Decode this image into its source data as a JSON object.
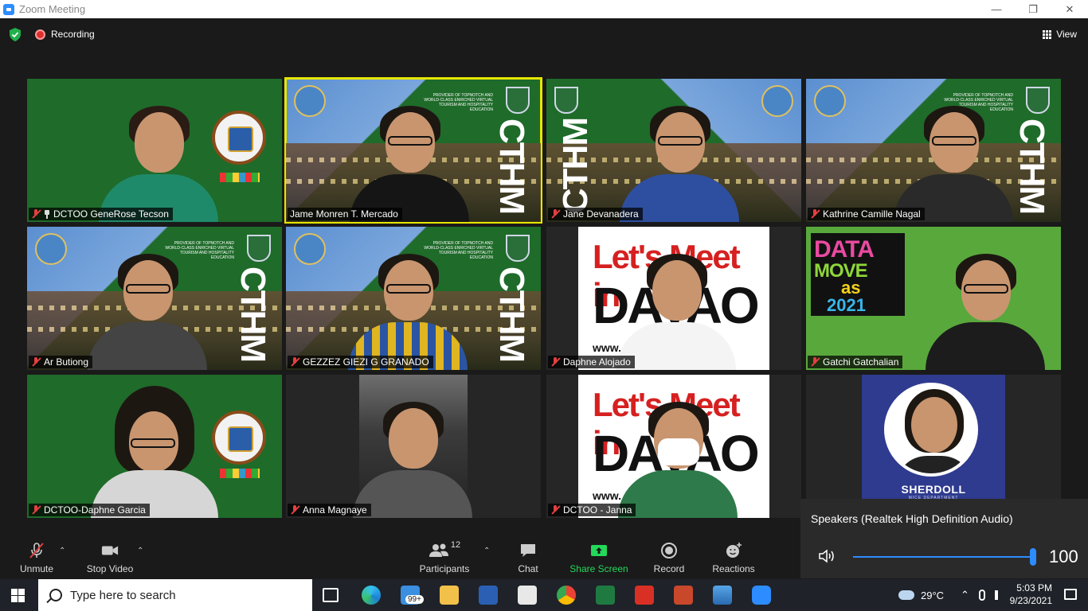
{
  "window": {
    "title": "Zoom Meeting"
  },
  "topbar": {
    "recording_label": "Recording",
    "view_label": "View"
  },
  "participants_tiles": [
    {
      "name": "DCTOO GeneRose Tecson",
      "pinned": true
    },
    {
      "name": "Jame Monren T. Mercado",
      "active_speaker": true
    },
    {
      "name": "Jane Devanadera"
    },
    {
      "name": "Kathrine Camille Nagal"
    },
    {
      "name": "Ar Butiong"
    },
    {
      "name": "GEZZEZ GIEZI G GRANADO"
    },
    {
      "name": "Daphne Alojado"
    },
    {
      "name": "Gatchi Gatchalian"
    },
    {
      "name": "DCTOO-Daphne Garcia"
    },
    {
      "name": "Anna Magnaye"
    },
    {
      "name": "DCTOO - Janna"
    },
    {
      "name": ""
    }
  ],
  "backgrounds": {
    "cthm": "CTHM",
    "cthm_sub": "PROVIDER OF TOPNOTCH AND WORLD-CLASS ENRICHED VIRTUAL TOURISM AND HOSPITALITY EDUCATION",
    "lmi_top": "Let's Meet in",
    "lmi_davao": "DAVAO",
    "lmi_www": "www.                 .com",
    "data_1": "DATA",
    "data_2": "MOVE",
    "data_3": "as",
    "data_4": "2021",
    "sherdoll": "SHERDOLL",
    "sherdoll_sub": "MICE DEPARTMENT"
  },
  "toolbar": {
    "unmute": "Unmute",
    "stop_video": "Stop Video",
    "participants": "Participants",
    "participants_count": "12",
    "chat": "Chat",
    "share_screen": "Share Screen",
    "record": "Record",
    "reactions": "Reactions"
  },
  "speakers_popup": {
    "device": "Speakers (Realtek High Definition Audio)",
    "volume": "100"
  },
  "taskbar": {
    "search_placeholder": "Type here to search",
    "mail_badge": "99+",
    "temperature": "29°C",
    "time": "5:03 PM",
    "date": "9/23/2021"
  },
  "colors": {
    "zoom_blue": "#2d8cff",
    "share_green": "#23d959",
    "muted_red": "#e34040",
    "active_yellow": "#e6e600"
  }
}
